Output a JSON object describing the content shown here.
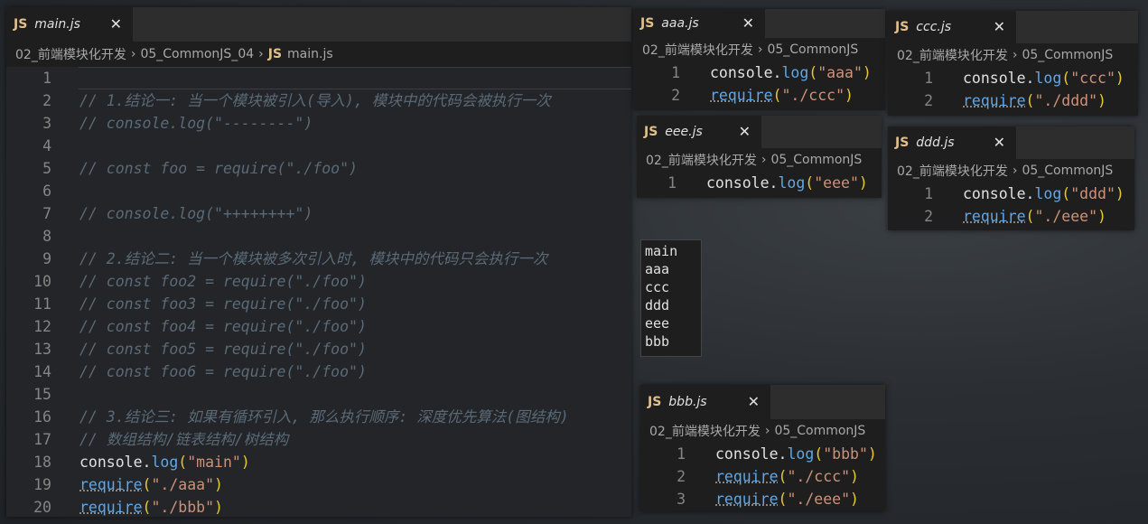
{
  "main": {
    "tab": {
      "icon": "JS",
      "name": "main.js",
      "close": "✕"
    },
    "breadcrumb": [
      "02_前端模块化开发",
      "05_CommonJS_04",
      "main.js"
    ],
    "lines": [
      {
        "n": "1",
        "text": ""
      },
      {
        "n": "2",
        "text": "// 1.结论一: 当一个模块被引入(导入), 模块中的代码会被执行一次"
      },
      {
        "n": "3",
        "text": "// console.log(\"--------\")"
      },
      {
        "n": "4",
        "text": ""
      },
      {
        "n": "5",
        "text": "// const foo = require(\"./foo\")"
      },
      {
        "n": "6",
        "text": ""
      },
      {
        "n": "7",
        "text": "// console.log(\"++++++++\")"
      },
      {
        "n": "8",
        "text": ""
      },
      {
        "n": "9",
        "text": "// 2.结论二: 当一个模块被多次引入时, 模块中的代码只会执行一次"
      },
      {
        "n": "10",
        "text": "// const foo2 = require(\"./foo\")"
      },
      {
        "n": "11",
        "text": "// const foo3 = require(\"./foo\")"
      },
      {
        "n": "12",
        "text": "// const foo4 = require(\"./foo\")"
      },
      {
        "n": "13",
        "text": "// const foo5 = require(\"./foo\")"
      },
      {
        "n": "14",
        "text": "// const foo6 = require(\"./foo\")"
      },
      {
        "n": "15",
        "text": ""
      },
      {
        "n": "16",
        "text": "// 3.结论三: 如果有循环引入, 那么执行顺序: 深度优先算法(图结构)"
      },
      {
        "n": "17",
        "text": "// 数组结构/链表结构/树结构"
      },
      {
        "n": "18",
        "text": "console.log(\"main\")"
      },
      {
        "n": "19",
        "text": "require(\"./aaa\")"
      },
      {
        "n": "20",
        "text": "require(\"./bbb\")"
      }
    ]
  },
  "aaa": {
    "tab": {
      "icon": "JS",
      "name": "aaa.js",
      "close": "✕"
    },
    "breadcrumb": [
      "02_前端模块化开发",
      "05_CommonJS"
    ],
    "lines": [
      {
        "n": "1",
        "text": "console.log(\"aaa\")"
      },
      {
        "n": "2",
        "text": "require(\"./ccc\")"
      }
    ]
  },
  "ccc": {
    "tab": {
      "icon": "JS",
      "name": "ccc.js",
      "close": "✕"
    },
    "breadcrumb": [
      "02_前端模块化开发",
      "05_CommonJS"
    ],
    "lines": [
      {
        "n": "1",
        "text": "console.log(\"ccc\")"
      },
      {
        "n": "2",
        "text": "require(\"./ddd\")"
      }
    ]
  },
  "eee": {
    "tab": {
      "icon": "JS",
      "name": "eee.js",
      "close": "✕"
    },
    "breadcrumb": [
      "02_前端模块化开发",
      "05_CommonJS"
    ],
    "lines": [
      {
        "n": "1",
        "text": "console.log(\"eee\")"
      }
    ]
  },
  "ddd": {
    "tab": {
      "icon": "JS",
      "name": "ddd.js",
      "close": "✕"
    },
    "breadcrumb": [
      "02_前端模块化开发",
      "05_CommonJS"
    ],
    "lines": [
      {
        "n": "1",
        "text": "console.log(\"ddd\")"
      },
      {
        "n": "2",
        "text": "require(\"./eee\")"
      }
    ]
  },
  "bbb": {
    "tab": {
      "icon": "JS",
      "name": "bbb.js",
      "close": "✕"
    },
    "breadcrumb": [
      "02_前端模块化开发",
      "05_CommonJS"
    ],
    "lines": [
      {
        "n": "1",
        "text": "console.log(\"bbb\")"
      },
      {
        "n": "2",
        "text": "require(\"./ccc\")"
      },
      {
        "n": "3",
        "text": "require(\"./eee\")"
      }
    ]
  },
  "output": [
    "main",
    "aaa",
    "ccc",
    "ddd",
    "eee",
    "bbb"
  ],
  "colors": {
    "comment": "#6a9955",
    "function": "#5fa8e8",
    "string": "#ce9178",
    "paren": "#e8c832",
    "js_icon": "#e2c08d"
  }
}
